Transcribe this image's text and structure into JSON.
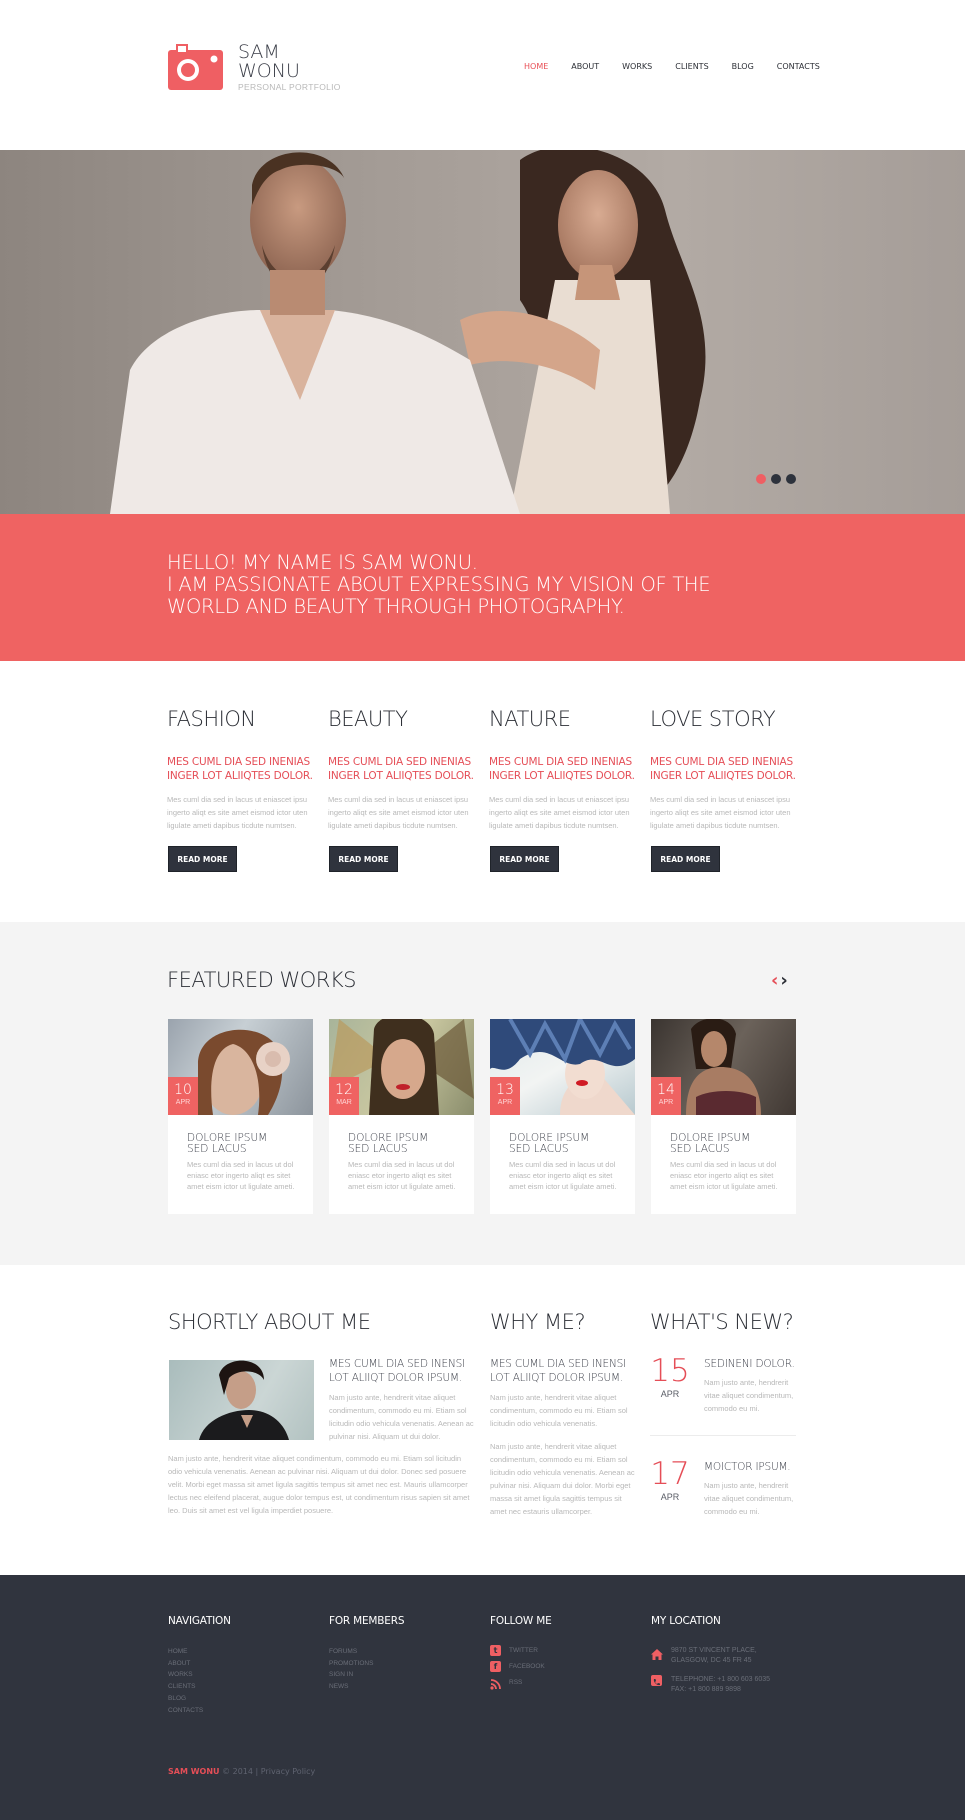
{
  "header": {
    "logo_line1": "SAM",
    "logo_line2": "WONU",
    "logo_subtitle": "PERSONAL PORTFOLIO",
    "nav": [
      "HOME",
      "ABOUT",
      "WORKS",
      "CLIENTS",
      "BLOG",
      "CONTACTS"
    ],
    "active_nav": "HOME"
  },
  "colors": {
    "accent": "#ef6362",
    "dark": "#30343e",
    "text_gray": "#b8b8b8"
  },
  "hero": {
    "slider_dots": 3,
    "active_dot": 1
  },
  "band": {
    "line1": "HELLO! MY NAME IS SAM WONU.",
    "line2": "I AM PASSIONATE ABOUT EXPRESSING MY VISION OF THE",
    "line3": "WORLD AND BEAUTY THROUGH PHOTOGRAPHY."
  },
  "categories": [
    {
      "title": "FASHION",
      "subtitle": "MES CUML DIA SED INENIAS INGER LOT ALIIQTES DOLOR.",
      "text": "Mes cuml dia sed in lacus ut eniascet ipsu ingerto aliqt es site amet eismod ictor uten ligulate ameti dapibus ticdute numtsen.",
      "button": "READ MORE"
    },
    {
      "title": "BEAUTY",
      "subtitle": "MES CUML DIA SED INENIAS INGER LOT ALIIQTES DOLOR.",
      "text": "Mes cuml dia sed in lacus ut eniascet ipsu ingerto aliqt es site amet eismod ictor uten ligulate ameti dapibus ticdute numtsen.",
      "button": "READ MORE"
    },
    {
      "title": "NATURE",
      "subtitle": "MES CUML DIA SED INENIAS INGER LOT ALIIQTES DOLOR.",
      "text": "Mes cuml dia sed in lacus ut eniascet ipsu ingerto aliqt es site amet eismod ictor uten ligulate ameti dapibus ticdute numtsen.",
      "button": "READ MORE"
    },
    {
      "title": "LOVE STORY",
      "subtitle": "MES CUML DIA SED INENIAS INGER LOT ALIIQTES DOLOR.",
      "text": "Mes cuml dia sed in lacus ut eniascet ipsu ingerto aliqt es site amet eismod ictor uten ligulate ameti dapibus ticdute numtsen.",
      "button": "READ MORE"
    }
  ],
  "featured": {
    "title": "FEATURED WORKS",
    "prev_icon": "‹",
    "next_icon": "›",
    "works": [
      {
        "day": "10",
        "month": "APR",
        "title_line1": "DOLORE IPSUM",
        "title_line2": "SED LACUS",
        "text": "Mes cuml dia sed in lacus ut dol eniasc etor ingerto aliqt es sitet amet eism ictor ut ligulate ameti."
      },
      {
        "day": "12",
        "month": "MAR",
        "title_line1": "DOLORE IPSUM",
        "title_line2": "SED LACUS",
        "text": "Mes cuml dia sed in lacus ut dol eniasc etor ingerto aliqt es sitet amet eism ictor ut ligulate ameti."
      },
      {
        "day": "13",
        "month": "APR",
        "title_line1": "DOLORE IPSUM",
        "title_line2": "SED LACUS",
        "text": "Mes cuml dia sed in lacus ut dol eniasc etor ingerto aliqt es sitet amet eism ictor ut ligulate ameti."
      },
      {
        "day": "14",
        "month": "APR",
        "title_line1": "DOLORE IPSUM",
        "title_line2": "SED LACUS",
        "text": "Mes cuml dia sed in lacus ut dol eniasc etor ingerto aliqt es sitet amet eism ictor ut ligulate ameti."
      }
    ]
  },
  "about": {
    "title": "SHORTLY ABOUT ME",
    "subtitle": "MES CUML DIA SED INENSI LOT ALIIQT DOLOR IPSUM.",
    "side_text": "Nam justo ante, hendrerit vitae aliquet condimentum, commodo eu mi. Etiam sol licitudin odio vehicula venenatis. Aenean ac pulvinar nisi. Aliquam ut dui dolor.",
    "body_text": "Nam justo ante, hendrerit vitae aliquet condimentum, commodo eu mi. Etiam sol licitudin odio vehicula venenatis. Aenean ac pulvinar nisi. Aliquam ut dui dolor. Donec sed posuere velit. Morbi eget massa sit amet ligula sagittis tempus sit amet nec est. Mauris ullamcorper lectus nec eleifend placerat, augue dolor tempus est, ut condimentum risus sapien sit amet leo. Duis sit amet est vel ligula imperdiet posuere."
  },
  "why": {
    "title": "WHY ME?",
    "subtitle": "MES CUML DIA SED INENSI LOT ALIIQT DOLOR IPSUM.",
    "text1": "Nam justo ante, hendrerit vitae aliquet condimentum, commodo eu mi. Etiam sol licitudin odio vehicula venenatis.",
    "text2": "Nam justo ante, hendrerit vitae aliquet condimentum, commodo eu mi. Etiam sol licitudin odio vehicula venenatis. Aenean ac pulvinar nisi. Aliquam dui dolor. Morbi eget massa sit amet ligula sagittis tempus sit amet nec estauris ullamcorper."
  },
  "news": {
    "title": "WHAT'S NEW?",
    "items": [
      {
        "day": "15",
        "month": "APR",
        "title": "SEDINENI DOLOR.",
        "text": "Nam justo ante, hendrerit vitae aliquet condimentum, commodo eu mi."
      },
      {
        "day": "17",
        "month": "APR",
        "title": "MOICTOR IPSUM.",
        "text": "Nam justo ante, hendrerit vitae aliquet condimentum, commodo eu mi."
      }
    ]
  },
  "footer": {
    "navigation": {
      "title": "NAVIGATION",
      "items": [
        "HOME",
        "ABOUT",
        "WORKS",
        "CLIENTS",
        "BLOG",
        "CONTACTS"
      ]
    },
    "members": {
      "title": "FOR MEMBERS",
      "items": [
        "FORUMS",
        "PROMOTIONS",
        "SIGN IN",
        "NEWS"
      ]
    },
    "follow": {
      "title": "FOLLOW ME",
      "items": [
        {
          "icon": "twitter-icon",
          "glyph": "t",
          "label": "TWITTER"
        },
        {
          "icon": "facebook-icon",
          "glyph": "f",
          "label": "FACEBOOK"
        },
        {
          "icon": "rss-icon",
          "glyph": ")",
          "label": "RSS"
        }
      ]
    },
    "location": {
      "title": "MY LOCATION",
      "address_line1": "9870 ST VINCENT PLACE,",
      "address_line2": "GLASGOW, DC 45 FR 45",
      "phone": "TELEPHONE: +1 800 603 6035",
      "fax": "FAX: +1 800 889 9898"
    },
    "copyright_brand": "SAM WONU",
    "copyright_text": "© 2014 |",
    "privacy": "Privacy Policy"
  }
}
